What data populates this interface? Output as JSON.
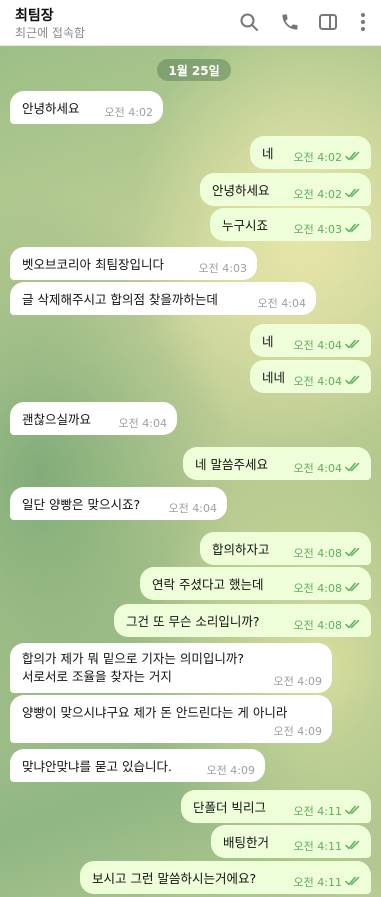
{
  "header": {
    "title": "최팀장",
    "status": "최근에 접속함"
  },
  "date_separator": "1월 25일",
  "messages": [
    {
      "dir": "in",
      "text": "안녕하세요",
      "time": "오전 4:02"
    },
    {
      "dir": "out",
      "text": "네",
      "time": "오전 4:02"
    },
    {
      "dir": "out",
      "text": "안녕하세요",
      "time": "오전 4:02"
    },
    {
      "dir": "out",
      "text": "누구시죠",
      "time": "오전 4:03"
    },
    {
      "dir": "in",
      "text": "벳오브코리아 최팀장입니다",
      "time": "오전 4:03"
    },
    {
      "dir": "in",
      "text": "글 삭제해주시고 합의점 찾을까하는데",
      "time": "오전 4:04"
    },
    {
      "dir": "out",
      "text": "네",
      "time": "오전 4:04"
    },
    {
      "dir": "out",
      "text": "네네",
      "time": "오전 4:04"
    },
    {
      "dir": "in",
      "text": "괜찮으실까요",
      "time": "오전 4:04"
    },
    {
      "dir": "out",
      "text": "네 말씀주세요",
      "time": "오전 4:04"
    },
    {
      "dir": "in",
      "text": "일단 양빵은 맞으시죠?",
      "time": "오전 4:04"
    },
    {
      "dir": "out",
      "text": "합의하자고",
      "time": "오전 4:08"
    },
    {
      "dir": "out",
      "text": "연락 주셨다고 했는데",
      "time": "오전 4:08"
    },
    {
      "dir": "out",
      "text": "그건 또 무슨 소리입니까?",
      "time": "오전 4:08"
    },
    {
      "dir": "in",
      "text": "합의가 제가 뭐 밑으로 기자는 의미입니까?\n서로서로 조율을 찾자는 거지",
      "time": "오전 4:09"
    },
    {
      "dir": "in",
      "text": "양빵이 맞으시냐구요 제가 돈 안드린다는 게 아니라",
      "time": "오전 4:09"
    },
    {
      "dir": "in",
      "text": "맞냐안맞냐를 묻고 있습니다.",
      "time": "오전 4:09"
    },
    {
      "dir": "out",
      "text": "단폴더 빅리그",
      "time": "오전 4:11"
    },
    {
      "dir": "out",
      "text": "배팅한거",
      "time": "오전 4:11"
    },
    {
      "dir": "out",
      "text": "보시고 그런 말씀하시는거에요?",
      "time": "오전 4:11"
    }
  ]
}
